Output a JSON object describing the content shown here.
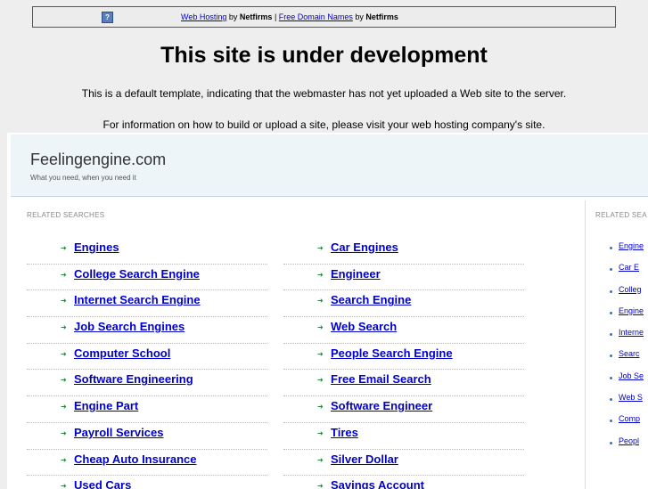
{
  "topbar": {
    "icon": "question-icon",
    "link1": "Web Hosting",
    "by1": "by",
    "brand1": "Netfirms",
    "sep": "|",
    "link2": "Free Domain Names",
    "by2": "by",
    "brand2": "Netfirms"
  },
  "main": {
    "title": "This site is under development",
    "desc1": "This is a default template, indicating that the webmaster has not yet uploaded a Web site to the server.",
    "desc2": "For information on how to build or upload a site, please visit your web hosting company's site."
  },
  "frame": {
    "site_title": "Feelingengine.com",
    "tagline": "What you need, when you need it",
    "header_edge": "/",
    "left_label": "RELATED SEARCHES",
    "right_label": "RELATED SEA",
    "col1": [
      "Engines",
      "College Search Engine",
      "Internet Search Engine",
      "Job Search Engines",
      "Computer School",
      "Software Engineering",
      "Engine Part",
      "Payroll Services",
      "Cheap Auto Insurance",
      "Used Cars"
    ],
    "col2": [
      "Car Engines",
      "Engineer",
      "Search Engine",
      "Web Search",
      "People Search Engine",
      "Free Email Search",
      "Software Engineer",
      "Tires",
      "Silver Dollar",
      "Savings Account"
    ],
    "right_items": [
      "Engine",
      "Car E",
      "Colleg",
      "Engine",
      "Interne",
      "Searc",
      "Job Se",
      "Web S",
      "Comp",
      "Peopl"
    ]
  }
}
